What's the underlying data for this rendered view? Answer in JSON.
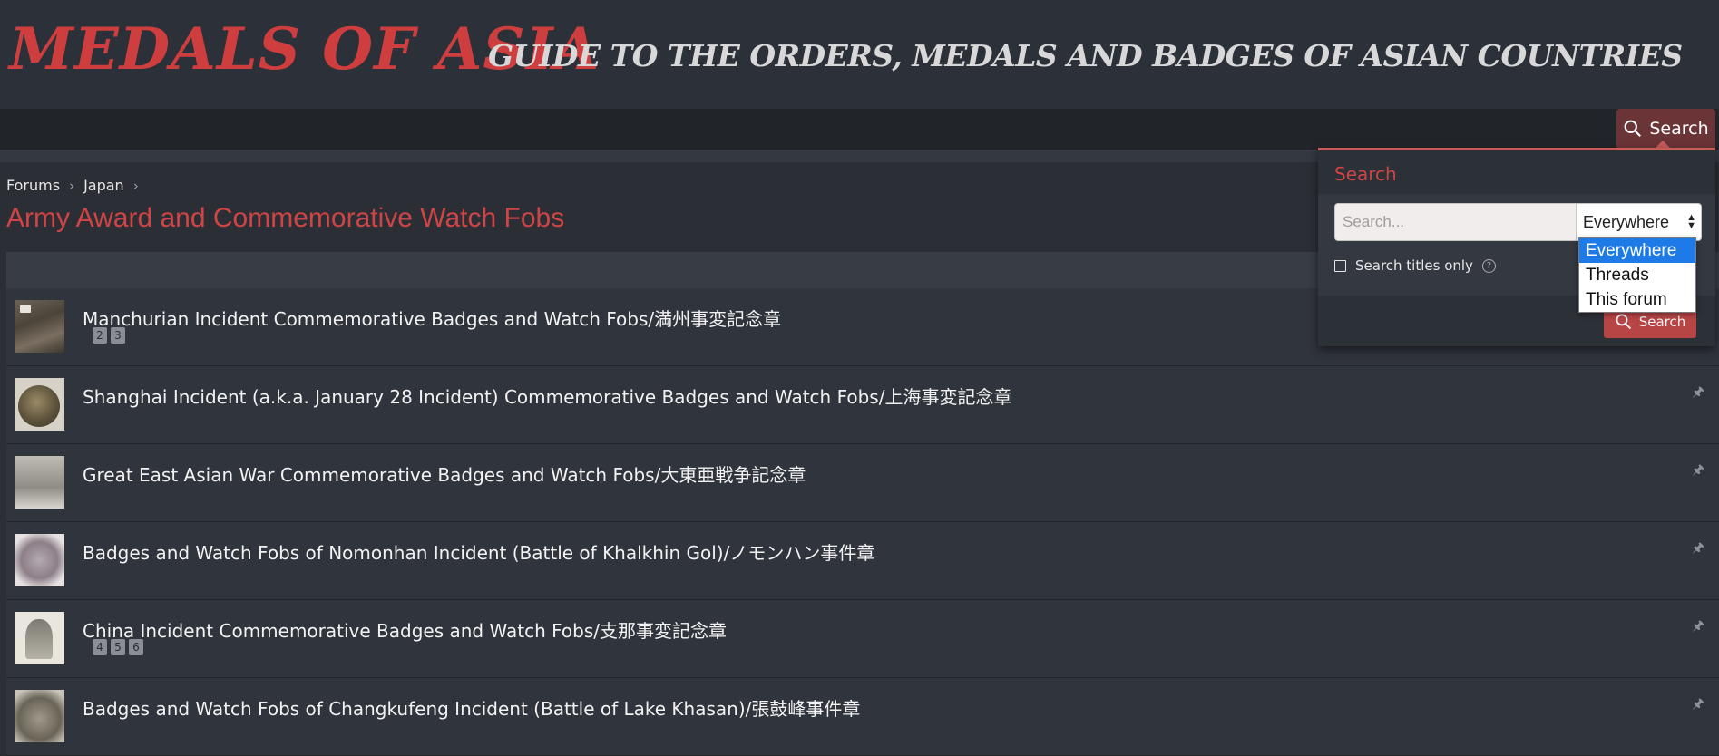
{
  "header": {
    "logo_main": "MEDALS OF ASIA",
    "logo_sub": "GUIDE TO THE ORDERS, MEDALS AND BADGES OF ASIAN COUNTRIES"
  },
  "nav": {
    "search_label": "Search"
  },
  "breadcrumb": {
    "items": [
      "Forums",
      "Japan"
    ]
  },
  "page": {
    "title": "Army Award and Commemorative Watch Fobs"
  },
  "threads": [
    {
      "title": "Manchurian Incident Commemorative Badges and Watch Fobs/満州事変記念章",
      "pages": [
        "2",
        "3"
      ]
    },
    {
      "title": "Shanghai Incident (a.k.a. January 28 Incident) Commemorative Badges and Watch Fobs/上海事変記念章",
      "pages": []
    },
    {
      "title": "Great East Asian War Commemorative Badges and Watch Fobs/大東亜戦争記念章",
      "pages": []
    },
    {
      "title": "Badges and Watch Fobs of Nomonhan Incident (Battle of Khalkhin Gol)/ノモンハン事件章",
      "pages": []
    },
    {
      "title": "China Incident Commemorative Badges and Watch Fobs/支那事変記念章",
      "pages": [
        "4",
        "5",
        "6"
      ]
    },
    {
      "title": "Badges and Watch Fobs of Changkufeng Incident (Battle of Lake Khasan)/張鼓峰事件章",
      "pages": []
    }
  ],
  "search_popup": {
    "heading": "Search",
    "placeholder": "Search...",
    "scope_selected": "Everywhere",
    "scope_options": [
      "Everywhere",
      "Threads",
      "This forum"
    ],
    "titles_only_label": "Search titles only",
    "button_label": "Search"
  },
  "colors": {
    "accent": "#cf4545",
    "background": "#2b2e35",
    "button": "#b84545"
  }
}
